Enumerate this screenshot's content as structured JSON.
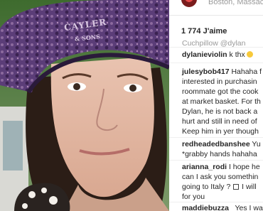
{
  "post": {
    "location": "Boston, Massac",
    "likes": "1 774 J'aime"
  },
  "photo": {
    "hat_text_1": "CAYLER",
    "hat_text_2": "SONS",
    "hat_text_3": "& ",
    "description": "Selfie of a woman wearing a purple patterned cap holding a cookie"
  },
  "comments": [
    {
      "user": "",
      "text": "Cuchpillow @dylan"
    },
    {
      "user": "dylanieviolin",
      "text": " k thx"
    },
    {
      "user": "julesybob417",
      "text": " Hahaha f"
    },
    {
      "user": "",
      "text": "interested in purchasin"
    },
    {
      "user": "",
      "text": "roommate got the cook"
    },
    {
      "user": "",
      "text": "at market basket. For th"
    },
    {
      "user": "",
      "text": "Dylan, he is not back a"
    },
    {
      "user": "",
      "text": "hurt and still in need of"
    },
    {
      "user": "",
      "text": "Keep him in yer though"
    },
    {
      "user": "redheadedbanshee",
      "text": " Yu"
    },
    {
      "user": "",
      "text": "*grabby hands hahaha"
    },
    {
      "user": "arianna_rodi",
      "text": " I hope he"
    },
    {
      "user": "",
      "text": "can I ask you somethin"
    },
    {
      "user": "",
      "text": "going to Italy ? "
    },
    {
      "user": "",
      "text": "for you"
    },
    {
      "user": "maddiebuzza_",
      "text": " Yes I wa"
    }
  ],
  "comment_extra": {
    "i_will": " I will",
    "emoji_label": "smile-emoji"
  }
}
